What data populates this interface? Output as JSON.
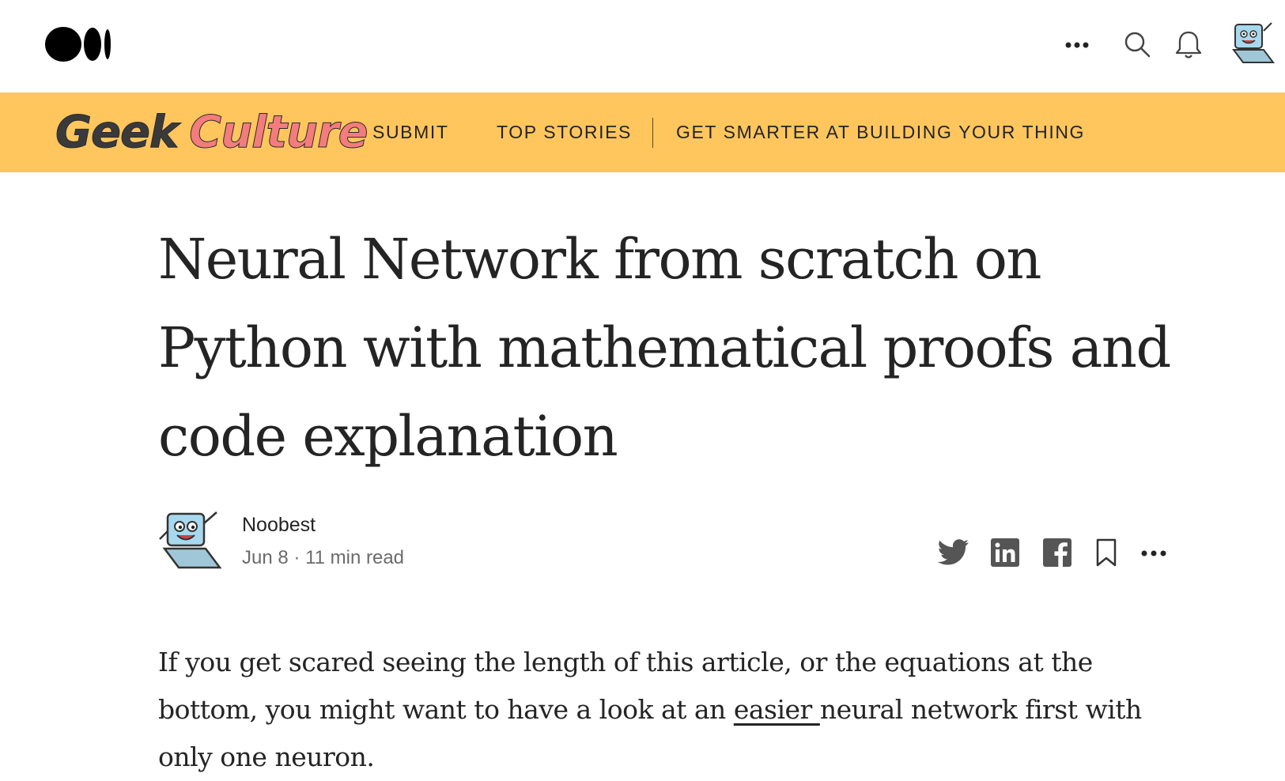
{
  "header": {
    "logo_icon": "medium-logo-icon",
    "actions": [
      "more-icon",
      "search-icon",
      "bell-icon",
      "avatar"
    ]
  },
  "publication": {
    "name_part1": "Geek",
    "name_part2": "Culture",
    "nav": {
      "submit": "SUBMIT",
      "top_stories": "TOP STORIES",
      "tagline": "GET SMARTER AT BUILDING YOUR THING"
    },
    "colors": {
      "bar": "#ffc65e",
      "culture": "#f47c7c"
    }
  },
  "article": {
    "title": "Neural Network from scratch on Python with mathematical proofs and code explanation",
    "author": "Noobest",
    "date": "Jun 8",
    "separator": "·",
    "read_time": "11 min read",
    "share_icons": [
      "twitter-icon",
      "linkedin-icon",
      "facebook-icon",
      "bookmark-icon",
      "more-icon"
    ],
    "body": {
      "before_link": "If you get scared seeing the length of this article, or the equations at the bottom, you might want to have a look at an ",
      "link_text": "easier ",
      "after_link": "neural network first with only one neuron."
    }
  }
}
